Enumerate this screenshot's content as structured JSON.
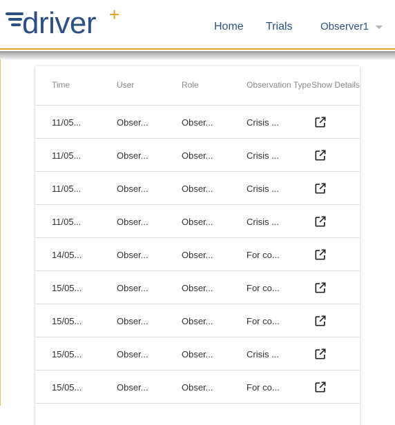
{
  "brand": {
    "name": "driver",
    "plus": "+"
  },
  "nav": {
    "home": "Home",
    "trials": "Trials",
    "user": "Observer1"
  },
  "table": {
    "columns": [
      "Time",
      "User",
      "Role",
      "Observation Type",
      "Show Details"
    ],
    "rows": [
      {
        "time": "11/05...",
        "user": "Obser...",
        "role": "Obser...",
        "type": "Crisis ..."
      },
      {
        "time": "11/05...",
        "user": "Obser...",
        "role": "Obser...",
        "type": "Crisis ..."
      },
      {
        "time": "11/05...",
        "user": "Obser...",
        "role": "Obser...",
        "type": "Crisis ..."
      },
      {
        "time": "11/05...",
        "user": "Obser...",
        "role": "Obser...",
        "type": "Crisis ..."
      },
      {
        "time": "14/05...",
        "user": "Obser...",
        "role": "Obser...",
        "type": "For co..."
      },
      {
        "time": "15/05...",
        "user": "Obser...",
        "role": "Obser...",
        "type": "For co..."
      },
      {
        "time": "15/05...",
        "user": "Obser...",
        "role": "Obser...",
        "type": "For co..."
      },
      {
        "time": "15/05...",
        "user": "Obser...",
        "role": "Obser...",
        "type": "Crisis ..."
      },
      {
        "time": "15/05...",
        "user": "Obser...",
        "role": "Obser...",
        "type": "For co..."
      }
    ],
    "details_icon": "open-in-new-icon"
  },
  "colors": {
    "brand": "#2d4f86",
    "accent": "#e0a020"
  }
}
